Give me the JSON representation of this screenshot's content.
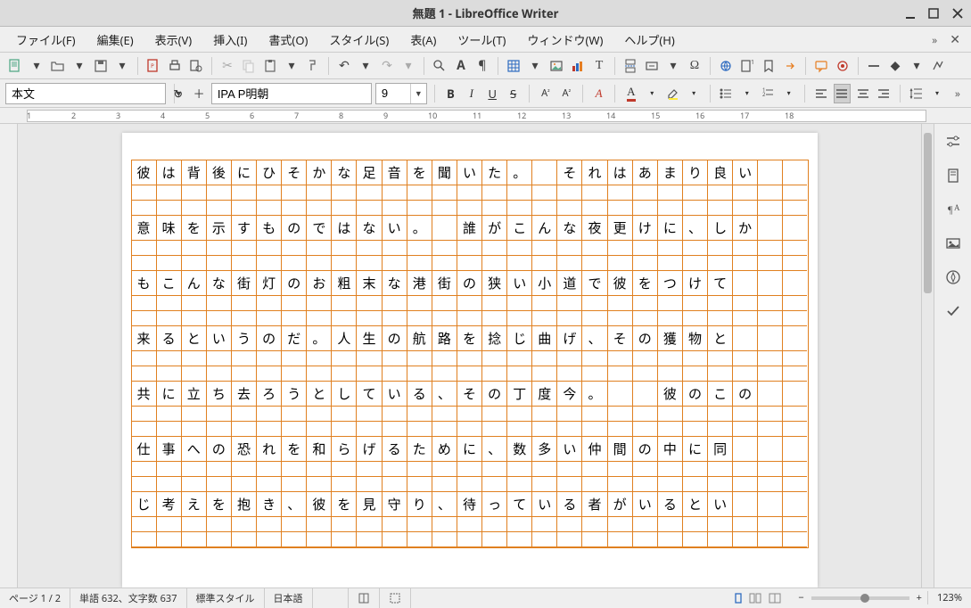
{
  "window": {
    "title": "無題 1 - LibreOffice Writer"
  },
  "menubar": {
    "items": [
      "ファイル(F)",
      "編集(E)",
      "表示(V)",
      "挿入(I)",
      "書式(O)",
      "スタイル(S)",
      "表(A)",
      "ツール(T)",
      "ウィンドウ(W)",
      "ヘルプ(H)"
    ]
  },
  "format": {
    "para_style": "本文",
    "font_name": "IPA P明朝",
    "font_size": "9"
  },
  "ruler_ticks": [
    "1",
    "2",
    "3",
    "4",
    "5",
    "6",
    "7",
    "8",
    "9",
    "10",
    "11",
    "12",
    "13",
    "14",
    "15",
    "16",
    "17",
    "18"
  ],
  "document": {
    "cols": 27,
    "lines": [
      "彼は背後にひそかな足音を聞いた。　それはあまり良い",
      "意味を示すものではない。　誰がこんな夜更けに、しか",
      "もこんな街灯のお粗末な港街の狭い小道で彼をつけて",
      "来るというのだ。人生の航路を捻じ曲げ、その獲物と",
      "共に立ち去ろうとしている、その丁度今。　　彼のこの",
      "仕事への恐れを和らげるために、数多い仲間の中に同",
      "じ考えを抱き、彼を見守り、待っている者がいるとい"
    ]
  },
  "status": {
    "page": "ページ 1 / 2",
    "words": "単語 632、文字数 637",
    "style": "標準スタイル",
    "lang": "日本語",
    "zoom": "123%"
  }
}
